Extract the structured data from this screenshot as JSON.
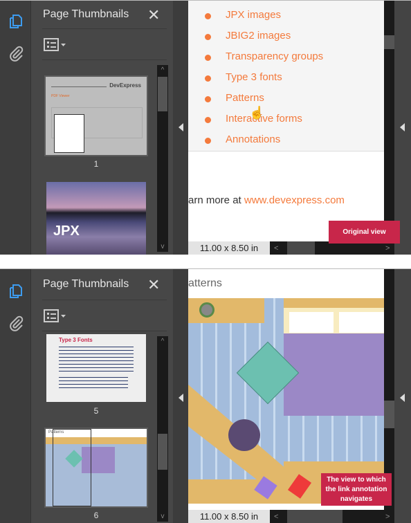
{
  "panel": {
    "title": "Page Thumbnails",
    "close_icon": "close-icon",
    "options_icon": "list-options-icon"
  },
  "sidebar": {
    "icons": [
      "pages-icon",
      "attachment-icon"
    ]
  },
  "accent": "#f47a3c",
  "callout_color": "#c8264a",
  "active_icon_color": "#3d9cf0",
  "top": {
    "thumbnails": [
      {
        "number": "1",
        "logo": "DevExpress",
        "heading": "PDF Viewer"
      },
      {
        "number": "",
        "caption": "JPX"
      }
    ],
    "list_items": [
      "JPX images",
      "JBIG2 images",
      "Transparency groups",
      "Type 3 fonts",
      "Patterns",
      "Interactive forms",
      "Annotations"
    ],
    "learn_prefix": "arn more at ",
    "learn_link": "www.devexpress.com",
    "page_size": "11.00 x 8.50 in",
    "callout": "Original view"
  },
  "bottom": {
    "thumbnails": [
      {
        "number": "5",
        "heading": "Type 3 Fonts"
      },
      {
        "number": "6",
        "heading": "Patterns"
      }
    ],
    "page_heading": "atterns",
    "page_size": "11.00 x 8.50 in",
    "callout": "The view to which the link annotation navigates"
  }
}
